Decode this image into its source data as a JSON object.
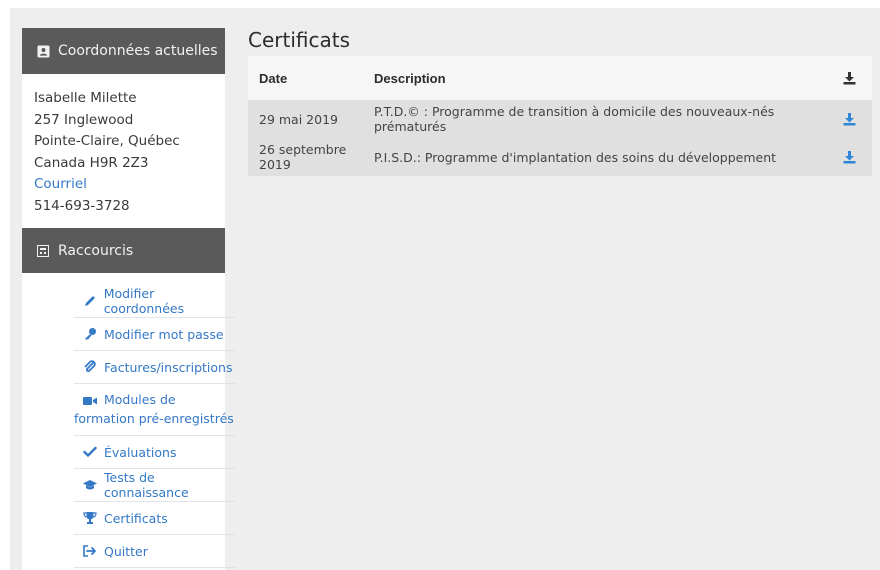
{
  "sidebar": {
    "contact_title": "Coordonnées actuelles",
    "contact": {
      "name": "Isabelle Milette",
      "street": "257 Inglewood",
      "city": "Pointe-Claire, Québec",
      "country_postal": "Canada H9R 2Z3",
      "email_link": "Courriel",
      "phone": "514-693-3728"
    },
    "shortcuts_title": "Raccourcis",
    "shortcuts": [
      {
        "label": "Modifier coordonnées",
        "icon": "pencil-icon"
      },
      {
        "label": "Modifier mot passe",
        "icon": "key-icon"
      },
      {
        "label": "Factures/inscriptions",
        "icon": "paperclip-icon"
      },
      {
        "label": "Modules de formation pré-enregistrés",
        "icon": "video-camera-icon"
      },
      {
        "label": "Évaluations",
        "icon": "check-icon"
      },
      {
        "label": "Tests de connaissance",
        "icon": "graduation-cap-icon"
      },
      {
        "label": "Certificats",
        "icon": "trophy-icon"
      },
      {
        "label": "Quitter",
        "icon": "sign-out-icon"
      }
    ]
  },
  "main": {
    "title": "Certificats",
    "table": {
      "headers": {
        "date": "Date",
        "description": "Description"
      },
      "rows": [
        {
          "date": "29 mai 2019",
          "description": "P.T.D.© : Programme de transition à domicile des nouveaux-nés prématurés"
        },
        {
          "date": "26 septembre 2019",
          "description": "P.I.S.D.: Programme d'implantation des soins du développement"
        }
      ]
    }
  },
  "colors": {
    "link": "#3478c6",
    "panel_header": "#5a5a5a",
    "background": "#eeeeee",
    "download_icon": "#2f86d6"
  }
}
